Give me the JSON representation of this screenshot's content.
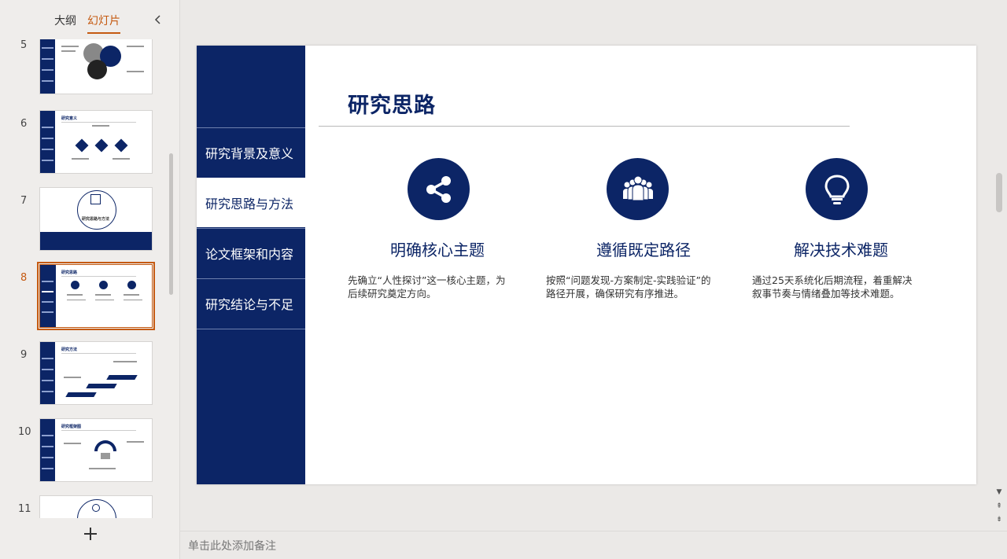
{
  "panel": {
    "tabs": [
      {
        "label": "大纲",
        "active": false
      },
      {
        "label": "幻灯片",
        "active": true
      }
    ],
    "collapse_icon": "chevron-left-icon",
    "add_icon": "plus-icon"
  },
  "thumbnails": [
    {
      "num": "5",
      "title": ""
    },
    {
      "num": "6",
      "title": "研究意义"
    },
    {
      "num": "7",
      "title": "研究思路与方法"
    },
    {
      "num": "8",
      "title": "研究思路",
      "active": true
    },
    {
      "num": "9",
      "title": "研究方法"
    },
    {
      "num": "10",
      "title": "研究框架图"
    },
    {
      "num": "11",
      "title": ""
    }
  ],
  "slide": {
    "title": "研究思路",
    "nav": [
      {
        "label": "研究背景及意义",
        "active": false
      },
      {
        "label": "研究思路与方法",
        "active": true
      },
      {
        "label": "论文框架和内容",
        "active": false
      },
      {
        "label": "研究结论与不足",
        "active": false
      }
    ],
    "features": [
      {
        "icon": "share-icon",
        "title": "明确核心主题",
        "desc": "先确立“人性探讨”这一核心主题，为后续研究奠定方向。"
      },
      {
        "icon": "group-icon",
        "title": "遵循既定路径",
        "desc": "按照“问题发现-方案制定-实践验证”的路径开展，确保研究有序推进。"
      },
      {
        "icon": "lightbulb-icon",
        "title": "解决技术难题",
        "desc": "通过25天系统化后期流程，着重解决叙事节奏与情绪叠加等技术难题。"
      }
    ]
  },
  "notes": {
    "placeholder": "单击此处添加备注"
  },
  "colors": {
    "navy": "#0c2566",
    "accent": "#c55a11"
  }
}
